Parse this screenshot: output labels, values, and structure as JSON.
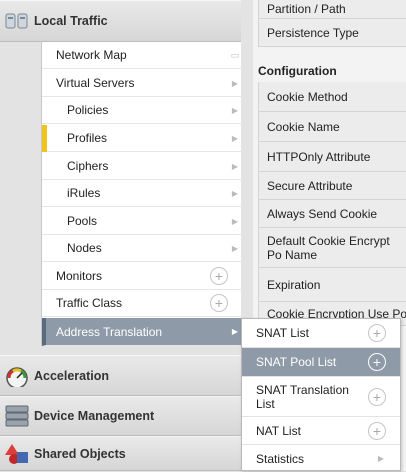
{
  "nav": {
    "local_traffic": "Local Traffic",
    "items": [
      {
        "label": "Network Map"
      },
      {
        "label": "Virtual Servers"
      },
      {
        "label": "Policies"
      },
      {
        "label": "Profiles"
      },
      {
        "label": "Ciphers"
      },
      {
        "label": "iRules"
      },
      {
        "label": "Pools"
      },
      {
        "label": "Nodes"
      },
      {
        "label": "Monitors"
      },
      {
        "label": "Traffic Class"
      },
      {
        "label": "Address Translation"
      }
    ],
    "acceleration": "Acceleration",
    "device_management": "Device Management",
    "shared_objects": "Shared Objects",
    "plus_symbol": "+",
    "arrow_symbol": "▶",
    "popout_symbol": "▭"
  },
  "panel": {
    "rows_top": [
      {
        "label": "Partition / Path"
      },
      {
        "label": "Persistence Type"
      }
    ],
    "section_title": "Configuration",
    "rows": [
      {
        "label": "Cookie Method"
      },
      {
        "label": "Cookie Name"
      },
      {
        "label": "HTTPOnly Attribute"
      },
      {
        "label": "Secure Attribute"
      },
      {
        "label": "Always Send Cookie"
      },
      {
        "label": "Default Cookie Encrypt Po Name"
      },
      {
        "label": "Expiration"
      },
      {
        "label": "Cookie Encryption Use Po"
      }
    ]
  },
  "flyout": {
    "items": [
      {
        "label": "SNAT List"
      },
      {
        "label": "SNAT Pool List"
      },
      {
        "label": "SNAT Translation List"
      },
      {
        "label": "NAT List"
      },
      {
        "label": "Statistics"
      }
    ]
  },
  "colors": {
    "active_bg": "#8f9aa8",
    "profiles_marker": "#f0c419"
  }
}
